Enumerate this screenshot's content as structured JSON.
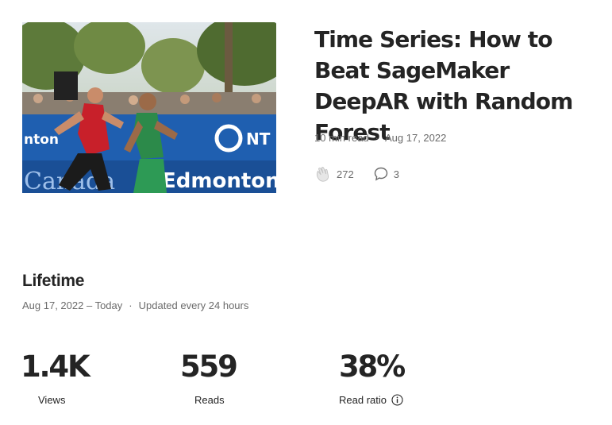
{
  "story": {
    "title": "Time Series: How to Beat SageMaker DeepAR with Random Forest",
    "read_time": "10 min read",
    "date": "Aug 17, 2022",
    "claps": "272",
    "responses": "3",
    "image": {
      "banner_left": "nton",
      "banner_right": "NT",
      "board_left": "Canada",
      "board_right": "Edmonton"
    }
  },
  "lifetime": {
    "heading": "Lifetime",
    "range": "Aug 17, 2022 – Today",
    "updated": "Updated every 24 hours"
  },
  "stats": [
    {
      "value": "1.4K",
      "label": "Views"
    },
    {
      "value": "559",
      "label": "Reads"
    },
    {
      "value": "38%",
      "label": "Read ratio"
    }
  ],
  "colors": {
    "text": "#242424",
    "muted": "#6b6b6b",
    "banner_blue": "#1f5fb0"
  },
  "icons": {
    "claps": "clap-icon",
    "responses": "speech-bubble-icon",
    "read_ratio_info": "info-icon"
  }
}
